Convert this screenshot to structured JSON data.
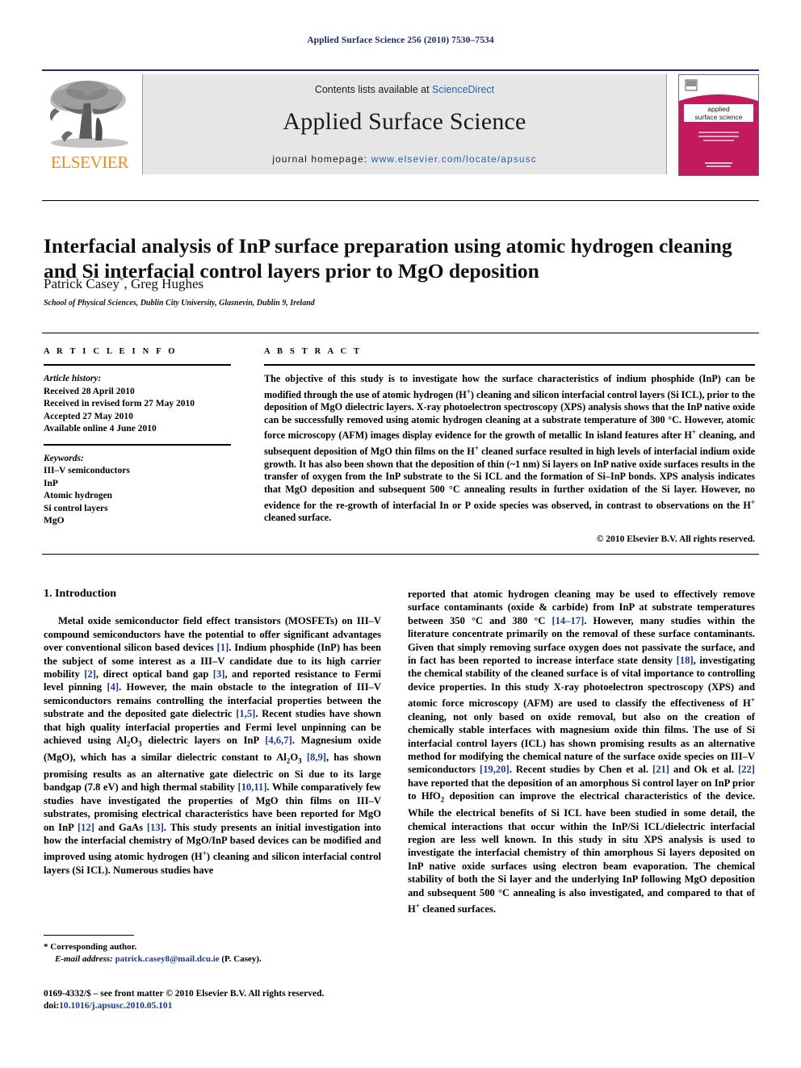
{
  "running_head": "Applied Surface Science 256 (2010) 7530–7534",
  "masthead": {
    "publisher_name": "ELSEVIER",
    "contents_prefix": "Contents lists available at ",
    "contents_link": "ScienceDirect",
    "journal_title": "Applied Surface Science",
    "homepage_prefix": "journal homepage:",
    "homepage_url": "www.elsevier.com/locate/apsusc",
    "cover": {
      "line1": "applied",
      "line2": "surface science"
    }
  },
  "article": {
    "title": "Interfacial analysis of InP surface preparation using atomic hydrogen cleaning and Si interfacial control layers prior to MgO deposition",
    "authors": "Patrick Casey, Greg Hughes",
    "author_marker": "*",
    "affiliation": "School of Physical Sciences, Dublin City University, Glasnevin, Dublin 9, Ireland"
  },
  "info": {
    "heading": "A R T I C L E    I N F O",
    "history_label": "Article history:",
    "history": [
      "Received 28 April 2010",
      "Received in revised form 27 May 2010",
      "Accepted 27 May 2010",
      "Available online 4 June 2010"
    ],
    "keywords_label": "Keywords:",
    "keywords": [
      "III–V semiconductors",
      "InP",
      "Atomic hydrogen",
      "Si control layers",
      "MgO"
    ]
  },
  "abstract": {
    "heading": "A B S T R A C T",
    "text": "The objective of this study is to investigate how the surface characteristics of indium phosphide (InP) can be modified through the use of atomic hydrogen (H*) cleaning and silicon interfacial control layers (Si ICL), prior to the deposition of MgO dielectric layers. X-ray photoelectron spectroscopy (XPS) analysis shows that the InP native oxide can be successfully removed using atomic hydrogen cleaning at a substrate temperature of 300 °C. However, atomic force microscopy (AFM) images display evidence for the growth of metallic In island features after H* cleaning, and subsequent deposition of MgO thin films on the H* cleaned surface resulted in high levels of interfacial indium oxide growth. It has also been shown that the deposition of thin (~1 nm) Si layers on InP native oxide surfaces results in the transfer of oxygen from the InP substrate to the Si ICL and the formation of Si–InP bonds. XPS analysis indicates that MgO deposition and subsequent 500 °C annealing results in further oxidation of the Si layer. However, no evidence for the re-growth of interfacial In or P oxide species was observed, in contrast to observations on the H* cleaned surface.",
    "copyright": "© 2010 Elsevier B.V. All rights reserved."
  },
  "body": {
    "section_number_title": "1.  Introduction",
    "left_paragraph": "Metal oxide semiconductor field effect transistors (MOSFETs) on III–V compound semiconductors have the potential to offer significant advantages over conventional silicon based devices [1]. Indium phosphide (InP) has been the subject of some interest as a III–V candidate due to its high carrier mobility [2], direct optical band gap [3], and reported resistance to Fermi level pinning [4]. However, the main obstacle to the integration of III–V semiconductors remains controlling the interfacial properties between the substrate and the deposited gate dielectric [1,5]. Recent studies have shown that high quality interfacial properties and Fermi level unpinning can be achieved using Al2O3 dielectric layers on InP [4,6,7]. Magnesium oxide (MgO), which has a similar dielectric constant to Al2O3 [8,9], has shown promising results as an alternative gate dielectric on Si due to its large bandgap (7.8 eV) and high thermal stability [10,11]. While comparatively few studies have investigated the properties of MgO thin films on III–V substrates, promising electrical characteristics have been reported for MgO on InP [12] and GaAs [13]. This study presents an initial investigation into how the interfacial chemistry of MgO/InP based devices can be modified and improved using atomic hydrogen (H*) cleaning and silicon interfacial control layers (Si ICL). Numerous studies have",
    "right_paragraph": "reported that atomic hydrogen cleaning may be used to effectively remove surface contaminants (oxide & carbide) from InP at substrate temperatures between 350 °C and 380 °C [14–17]. However, many studies within the literature concentrate primarily on the removal of these surface contaminants. Given that simply removing surface oxygen does not passivate the surface, and in fact has been reported to increase interface state density [18], investigating the chemical stability of the cleaned surface is of vital importance to controlling device properties. In this study X-ray photoelectron spectroscopy (XPS) and atomic force microscopy (AFM) are used to classify the effectiveness of H* cleaning, not only based on oxide removal, but also on the creation of chemically stable interfaces with magnesium oxide thin films. The use of Si interfacial control layers (ICL) has shown promising results as an alternative method for modifying the chemical nature of the surface oxide species on III–V semiconductors [19,20]. Recent studies by Chen et al. [21] and Ok et al. [22] have reported that the deposition of an amorphous Si control layer on InP prior to HfO2 deposition can improve the electrical characteristics of the device. While the electrical benefits of Si ICL have been studied in some detail, the chemical interactions that occur within the InP/Si ICL/dielectric interfacial region are less well known. In this study in situ XPS analysis is used to investigate the interfacial chemistry of thin amorphous Si layers deposited on InP native oxide surfaces using electron beam evaporation. The chemical stability of both the Si layer and the underlying InP following MgO deposition and subsequent 500 °C annealing is also investigated, and compared to that of H* cleaned surfaces."
  },
  "footer": {
    "corresponding_marker": "*",
    "corresponding_text": "Corresponding author.",
    "email_label": "E-mail address:",
    "email": "patrick.casey8@mail.dcu.ie",
    "email_suffix": "(P. Casey).",
    "issn_line": "0169-4332/$ – see front matter © 2010 Elsevier B.V. All rights reserved.",
    "doi_label": "doi:",
    "doi": "10.1016/j.apsusc.2010.05.101"
  },
  "colors": {
    "link": "#2a5db0",
    "reference": "#1a3a8c",
    "running_head": "#1a2a6c",
    "elsevier_orange": "#ec8b23",
    "cover_magenta": "#c3195d",
    "masthead_bg": "#e6e6e6"
  }
}
